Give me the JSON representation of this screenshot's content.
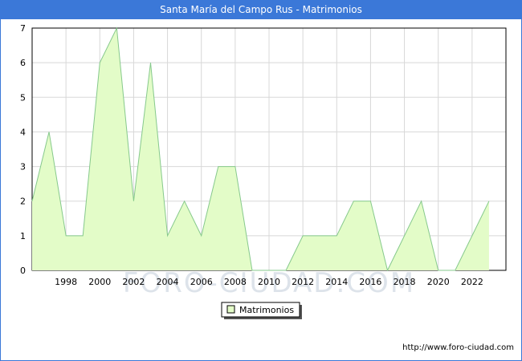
{
  "header": {
    "title": "Santa María del Campo Rus - Matrimonios"
  },
  "footer": {
    "source": "http://www.foro-ciudad.com"
  },
  "watermark": "FORO-CIUDAD.COM",
  "chart_data": {
    "type": "area",
    "title": "Santa María del Campo Rus - Matrimonios",
    "xlabel": "",
    "ylabel": "",
    "x": [
      1996,
      1997,
      1998,
      1999,
      2000,
      2001,
      2002,
      2003,
      2004,
      2005,
      2006,
      2007,
      2008,
      2009,
      2010,
      2011,
      2012,
      2013,
      2014,
      2015,
      2016,
      2017,
      2018,
      2019,
      2020,
      2021,
      2022,
      2023
    ],
    "series": [
      {
        "name": "Matrimonios",
        "values": [
          2,
          4,
          1,
          1,
          6,
          7,
          2,
          6,
          1,
          2,
          1,
          3,
          3,
          0,
          0,
          0,
          1,
          1,
          1,
          2,
          2,
          0,
          1,
          2,
          0,
          0,
          1,
          2
        ]
      }
    ],
    "xticks": [
      1998,
      2000,
      2002,
      2004,
      2006,
      2008,
      2010,
      2012,
      2014,
      2016,
      2018,
      2020,
      2022
    ],
    "yticks": [
      0,
      1,
      2,
      3,
      4,
      5,
      6,
      7
    ],
    "xlim": [
      1996,
      2024
    ],
    "ylim": [
      0,
      7
    ],
    "grid": true,
    "legend": "bottom-center",
    "colors": {
      "fill": "#e3fcc8",
      "line": "#86c98c",
      "grid": "#d8d8d8",
      "header": "#3b78d8"
    }
  }
}
